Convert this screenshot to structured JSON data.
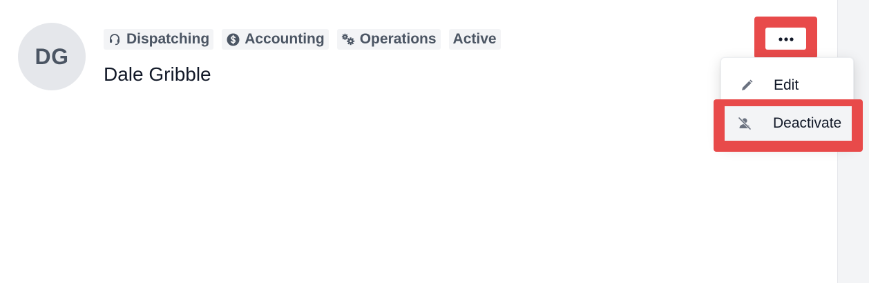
{
  "user": {
    "initials": "DG",
    "name": "Dale Gribble"
  },
  "tags": [
    {
      "label": "Dispatching",
      "icon": "headset-icon"
    },
    {
      "label": "Accounting",
      "icon": "dollar-circle-icon"
    },
    {
      "label": "Operations",
      "icon": "gears-icon"
    },
    {
      "label": "Active",
      "icon": ""
    }
  ],
  "menu": {
    "trigger_icon": "more-horizontal-icon",
    "items": [
      {
        "label": "Edit",
        "icon": "pencil-icon"
      },
      {
        "label": "Deactivate",
        "icon": "user-slash-icon"
      }
    ]
  },
  "colors": {
    "highlight": "#e84a4a",
    "tag_bg": "#f3f4f6",
    "tag_text": "#4b5563",
    "avatar_bg": "#e5e7eb"
  }
}
